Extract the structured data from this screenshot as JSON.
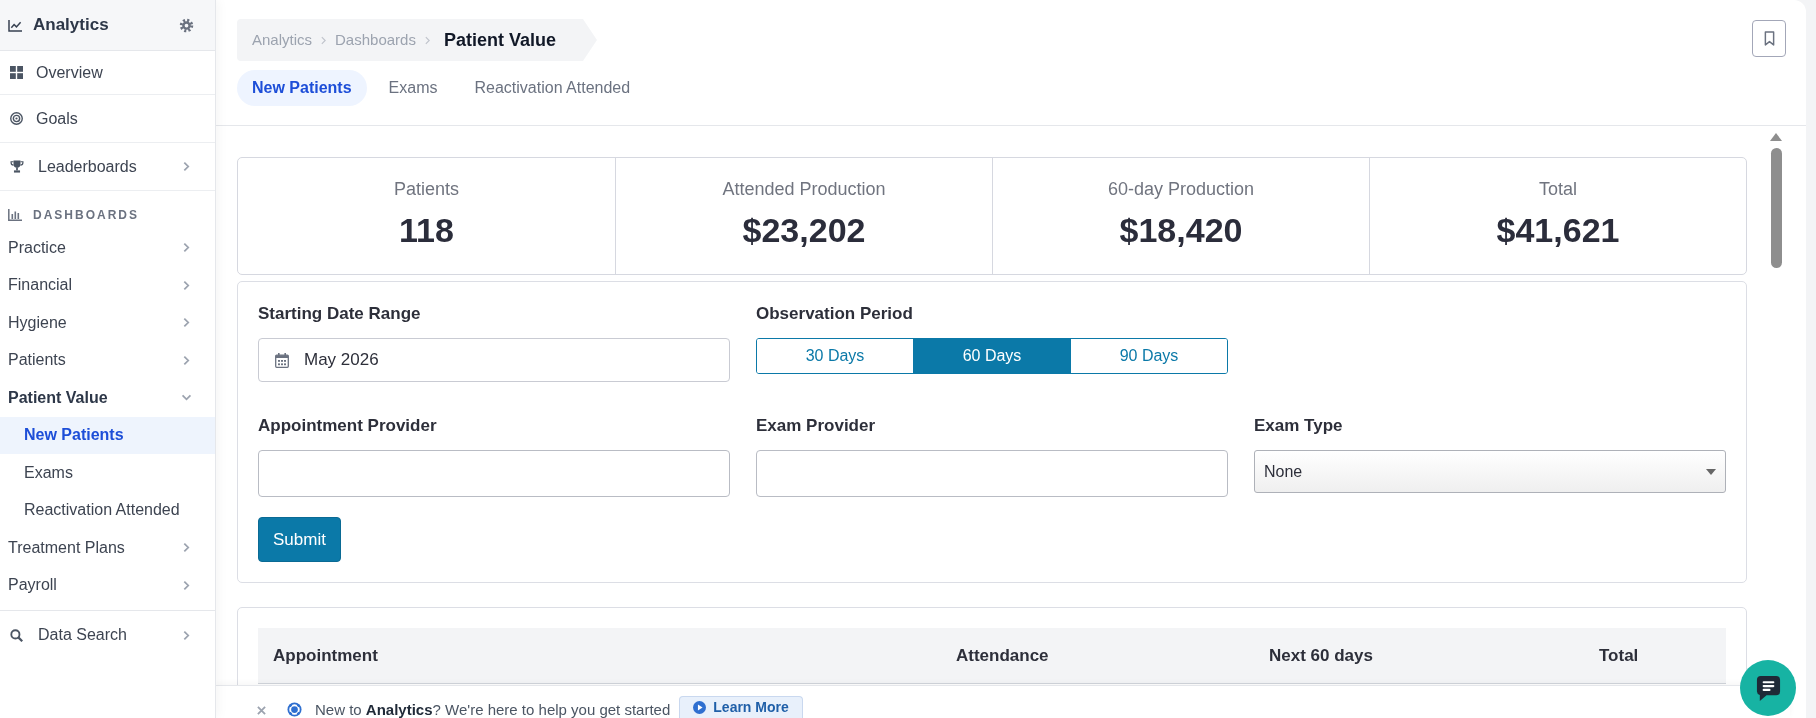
{
  "sidebar": {
    "title": "Analytics",
    "top_items": [
      {
        "label": "Overview",
        "selected": false
      },
      {
        "label": "Goals",
        "selected": false
      },
      {
        "label": "Leaderboards",
        "expanded": false
      }
    ],
    "section": {
      "title": "DASHBOARDS",
      "items": [
        {
          "label": "Practice",
          "expanded": false
        },
        {
          "label": "Financial",
          "expanded": false
        },
        {
          "label": "Hygiene",
          "expanded": false
        },
        {
          "label": "Patients",
          "expanded": false
        },
        {
          "label": "Patient Value",
          "expanded": true,
          "children": [
            {
              "label": "New Patients",
              "selected": true
            },
            {
              "label": "Exams",
              "selected": false
            },
            {
              "label": "Reactivation Attended",
              "selected": false
            }
          ]
        },
        {
          "label": "Treatment Plans",
          "expanded": false
        },
        {
          "label": "Payroll",
          "expanded": false
        }
      ]
    },
    "bottom_items": [
      {
        "label": "Data Search",
        "expanded": false
      }
    ]
  },
  "breadcrumb": [
    "Analytics",
    "Dashboards",
    "Patient Value"
  ],
  "tabs": [
    {
      "label": "New Patients",
      "selected": true
    },
    {
      "label": "Exams",
      "selected": false
    },
    {
      "label": "Reactivation Attended",
      "selected": false
    }
  ],
  "stats": [
    {
      "label": "Patients",
      "value": "118"
    },
    {
      "label": "Attended Production",
      "value": "$23,202"
    },
    {
      "label": "60-day Production",
      "value": "$18,420"
    },
    {
      "label": "Total",
      "value": "$41,621"
    }
  ],
  "filters": {
    "rows": [
      [
        {
          "kind": "date",
          "label": "Starting Date Range",
          "value": "May 2026"
        },
        {
          "kind": "segmented",
          "label": "Observation Period",
          "options": [
            {
              "label": "30 Days",
              "selected": false
            },
            {
              "label": "60 Days",
              "selected": true
            },
            {
              "label": "90 Days",
              "selected": false
            }
          ]
        }
      ],
      [
        {
          "kind": "text",
          "label": "Appointment Provider"
        },
        {
          "kind": "text",
          "label": "Exam Provider"
        },
        {
          "kind": "select",
          "label": "Exam Type",
          "value": "None"
        }
      ]
    ],
    "submit": "Submit"
  },
  "table": {
    "columns": [
      "Appointment",
      "Attendance",
      "Next 60 days",
      "Total"
    ]
  },
  "banner": {
    "text": "New to **Analytics**? We're here to help you get started",
    "button": "Learn More"
  }
}
